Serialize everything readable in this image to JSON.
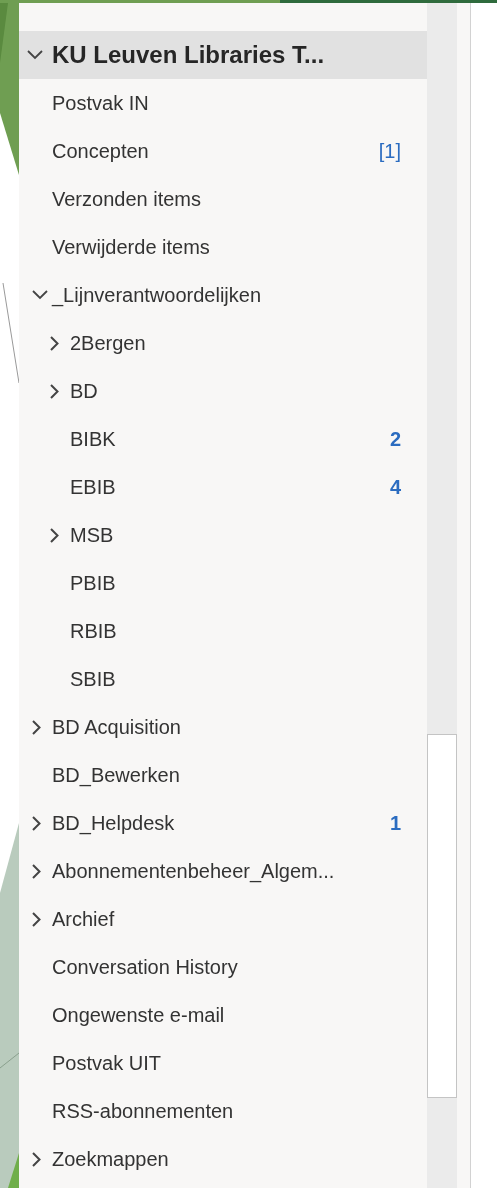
{
  "folder_pane": {
    "account": {
      "label": "KU Leuven Libraries T...",
      "expanded": true,
      "selected": true
    },
    "folders": [
      {
        "label": "Postvak IN",
        "selected": false
      },
      {
        "label": "Concepten",
        "selected": false,
        "count": "[1]",
        "unread": false
      },
      {
        "label": "Verzonden items",
        "selected": false
      },
      {
        "label": "Verwijderde items",
        "selected": false
      },
      {
        "label": "_Lijnverantwoordelijken",
        "selected": false,
        "expanded": true,
        "children": [
          {
            "label": "2Bergen",
            "selected": false,
            "expanded": false
          },
          {
            "label": "BD",
            "selected": false,
            "expanded": false
          },
          {
            "label": "BIBK",
            "selected": false,
            "count": "2",
            "unread": true
          },
          {
            "label": "EBIB",
            "selected": false,
            "count": "4",
            "unread": true
          },
          {
            "label": "MSB",
            "selected": false,
            "expanded": false
          },
          {
            "label": "PBIB",
            "selected": false
          },
          {
            "label": "RBIB",
            "selected": false
          },
          {
            "label": "SBIB",
            "selected": false
          }
        ]
      },
      {
        "label": "BD Acquisition",
        "selected": false,
        "expanded": false
      },
      {
        "label": "BD_Bewerken",
        "selected": false
      },
      {
        "label": "BD_Helpdesk",
        "selected": false,
        "expanded": false,
        "count": "1",
        "unread": true
      },
      {
        "label": "Abonnementenbeheer_Algem...",
        "selected": false,
        "expanded": false
      },
      {
        "label": "Archief",
        "selected": false,
        "expanded": false
      },
      {
        "label": "Conversation History",
        "selected": false
      },
      {
        "label": "Ongewenste e-mail",
        "selected": false
      },
      {
        "label": "Postvak UIT",
        "selected": false
      },
      {
        "label": "RSS-abonnementen",
        "selected": false
      },
      {
        "label": "Zoekmappen",
        "selected": false,
        "expanded": false
      }
    ]
  }
}
